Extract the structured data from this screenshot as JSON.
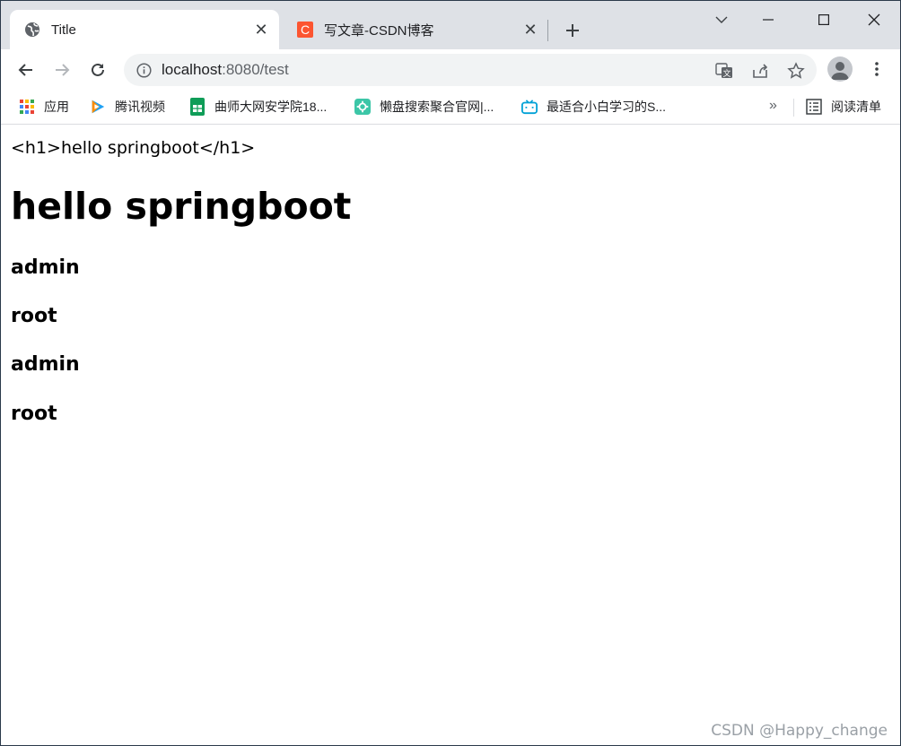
{
  "browser": {
    "tabs": [
      {
        "title": "Title",
        "active": true,
        "icon": "globe-icon"
      },
      {
        "title": "写文章-CSDN博客",
        "active": false,
        "icon": "csdn-c-icon",
        "icon_color": "#fc5531",
        "icon_letter": "C"
      }
    ],
    "address": {
      "host": "localhost",
      "rest": ":8080/test"
    },
    "bookmarks": [
      {
        "label": "应用",
        "icon": "apps-grid-icon"
      },
      {
        "label": "腾讯视频",
        "icon": "tencent-video-icon"
      },
      {
        "label": "曲师大网安学院18...",
        "icon": "sheets-icon"
      },
      {
        "label": "懒盘搜索聚合官网|...",
        "icon": "gear-badge-icon"
      },
      {
        "label": "最适合小白学习的S...",
        "icon": "bilibili-icon"
      }
    ],
    "bookmarks_overflow": "»",
    "reading_list": "阅读清单"
  },
  "page": {
    "raw_text": "<h1>hello springboot</h1>",
    "heading": "hello springboot",
    "items": [
      "admin",
      "root",
      "admin",
      "root"
    ]
  },
  "watermark": "CSDN @Happy_change",
  "colors": {
    "tabstrip": "#dee1e6",
    "omnibox": "#f1f3f4",
    "csdn": "#fc5531"
  }
}
